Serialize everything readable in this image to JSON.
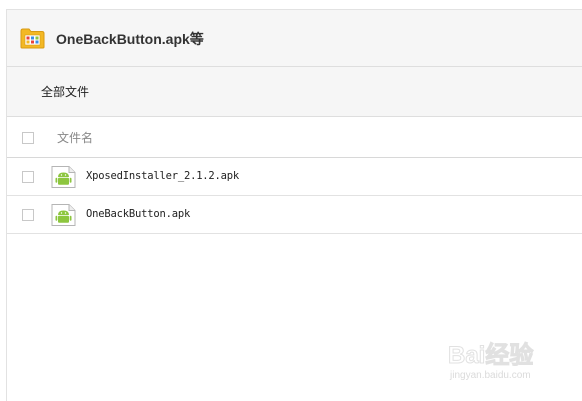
{
  "title_bar": {
    "icon": "folder-icon",
    "title": "OneBackButton.apk等"
  },
  "breadcrumb": {
    "label": "全部文件"
  },
  "list_header": {
    "filename_column": "文件名"
  },
  "files": [
    {
      "name": "XposedInstaller_2.1.2.apk",
      "icon": "android-apk-icon"
    },
    {
      "name": "OneBackButton.apk",
      "icon": "android-apk-icon"
    }
  ],
  "watermark": {
    "logo_text": "Bai经验",
    "url": "jingyan.baidu.com"
  },
  "colors": {
    "header_bg": "#f6f6f6",
    "border": "#dedede",
    "android_green": "#8dc63f",
    "folder_yellow": "#f3b824"
  }
}
